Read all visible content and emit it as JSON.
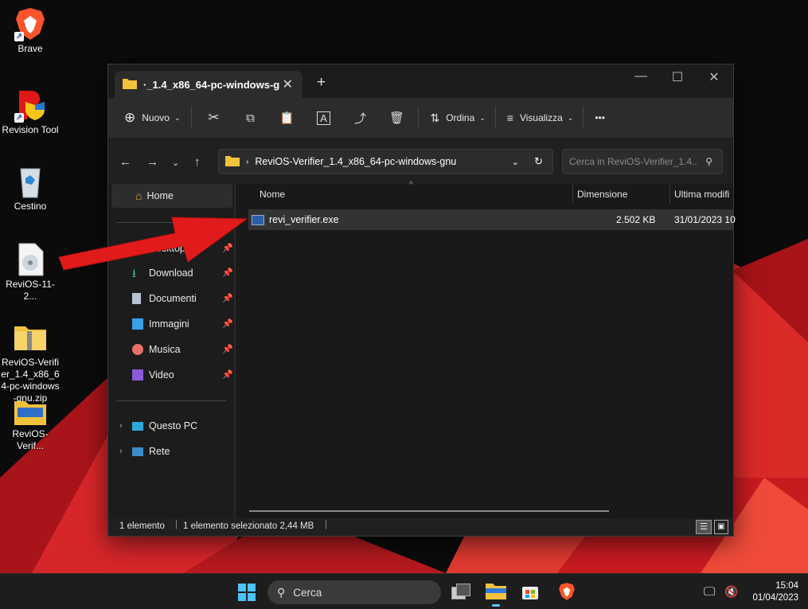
{
  "desktop": {
    "icons": [
      {
        "label": "Brave"
      },
      {
        "label": "Revision Tool"
      },
      {
        "label": "Cestino"
      },
      {
        "label": "ReviOS-11-2..."
      },
      {
        "label": "ReviOS-Verifier_1.4_x86_64-pc-windows-gnu.zip"
      },
      {
        "label": "ReviOS-Verif..."
      }
    ]
  },
  "window": {
    "tab_title": "ReviOS-Verifier_1.4_x86_64-pc-windows-gnu",
    "tab_title_visible": "·_1.4_x86_64-pc-windows-gnu",
    "toolbar": {
      "new_label": "Nuovo",
      "sort_label": "Ordina",
      "view_label": "Visualizza",
      "more_label": "•••"
    },
    "address": {
      "path": "ReviOS-Verifier_1.4_x86_64-pc-windows-gnu",
      "search_placeholder": "Cerca in ReviOS-Verifier_1.4..."
    },
    "sidebar": {
      "home": "Home",
      "quick": [
        {
          "label": "Desktop"
        },
        {
          "label": "Download"
        },
        {
          "label": "Documenti"
        },
        {
          "label": "Immagini"
        },
        {
          "label": "Musica"
        },
        {
          "label": "Video"
        }
      ],
      "locations": [
        {
          "label": "Questo PC"
        },
        {
          "label": "Rete"
        }
      ]
    },
    "columns": {
      "name": "Nome",
      "size": "Dimensione",
      "modified": "Ultima modifi"
    },
    "files": [
      {
        "name": "revi_verifier.exe",
        "size": "2.502 KB",
        "modified": "31/01/2023 10"
      }
    ],
    "status": {
      "count": "1 elemento",
      "selected": "1 elemento selezionato 2,44 MB"
    }
  },
  "taskbar": {
    "search_label": "Cerca",
    "time": "15:04",
    "date": "01/04/2023"
  },
  "colors": {
    "accent_arrow": "#e11b1b",
    "folder": "#f3c23c",
    "wallpaper_red": "#c8181c"
  }
}
